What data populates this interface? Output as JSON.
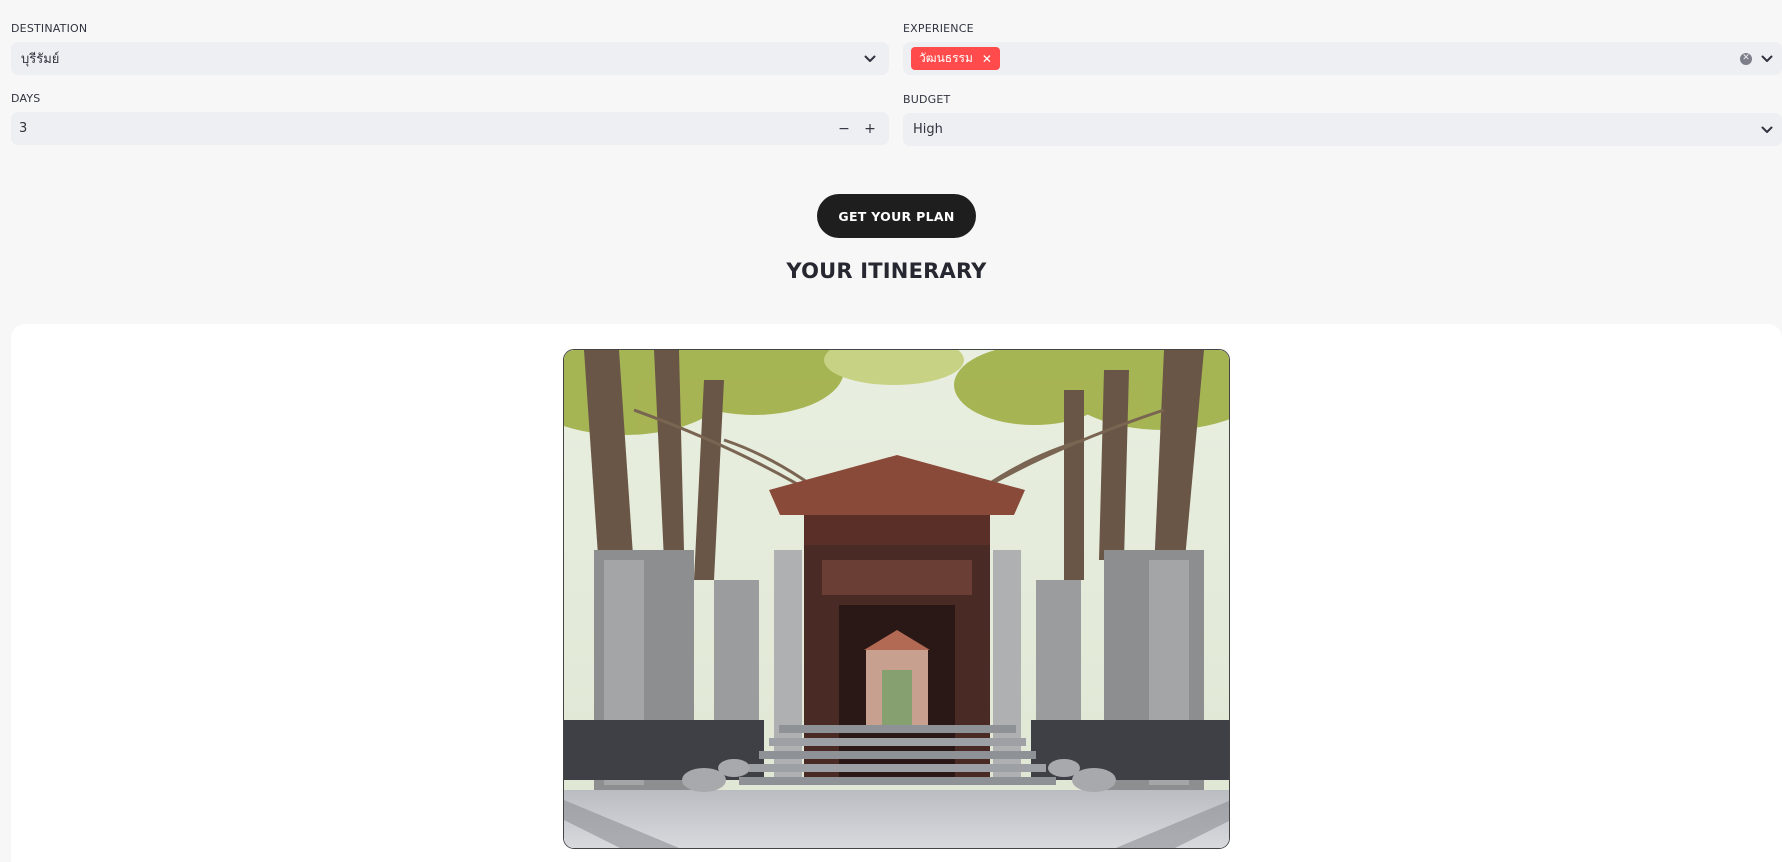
{
  "form": {
    "destination": {
      "label": "DESTINATION",
      "value": "บุรีรัมย์"
    },
    "experience": {
      "label": "EXPERIENCE",
      "tags": [
        "วัฒนธรรม"
      ]
    },
    "days": {
      "label": "DAYS",
      "value": "3",
      "decrement": "−",
      "increment": "+"
    },
    "budget": {
      "label": "BUDGET",
      "value": "High"
    }
  },
  "actions": {
    "get_plan_label": "GET YOUR PLAN"
  },
  "itinerary": {
    "title": "YOUR ITINERARY"
  },
  "icons": {
    "dropdown": "chevron-down-icon",
    "tag_remove": "close-icon",
    "clear_all": "clear-circle-icon"
  },
  "colors": {
    "accent_tag": "#ff4b4b",
    "button_bg": "#1e1e1e",
    "field_bg": "#eeeff2"
  }
}
